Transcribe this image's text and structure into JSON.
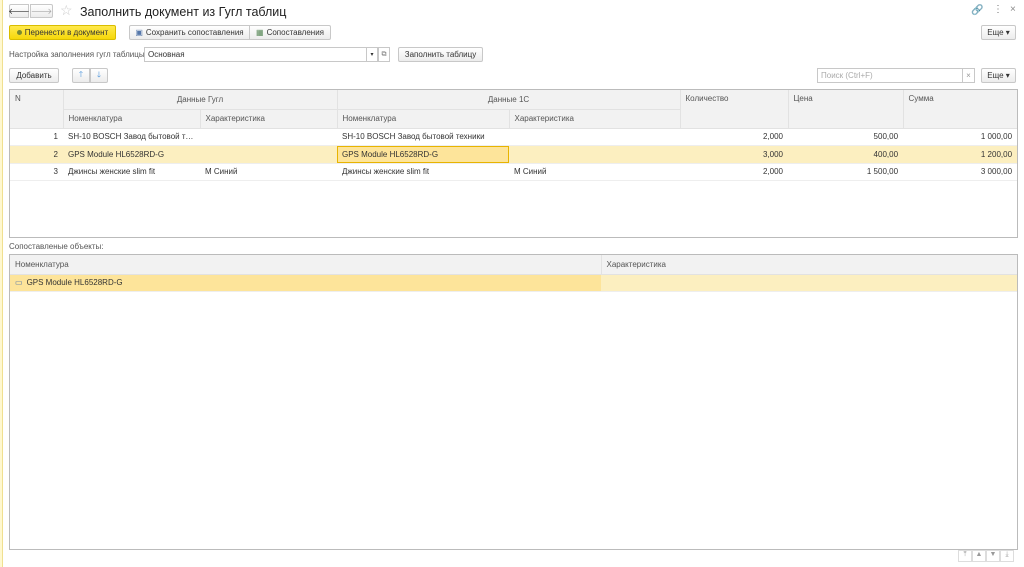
{
  "window": {
    "title": "Заполнить документ из Гугл таблиц"
  },
  "toolbar": {
    "transfer": "Перенести в документ",
    "save_mapping": "Сохранить сопоставления",
    "mappings": "Сопоставления",
    "more": "Еще ▾"
  },
  "settings": {
    "label": "Настройка заполнения гугл таблицы:",
    "value": "Основная",
    "fill_button": "Заполнить таблицу"
  },
  "table_toolbar": {
    "add": "Добавить",
    "search_placeholder": "Поиск (Ctrl+F)",
    "more": "Еще ▾"
  },
  "main_table": {
    "headers": {
      "n": "N",
      "google": "Данные Гугл",
      "c1": "Данные 1С",
      "nom": "Номенклатура",
      "char": "Характеристика",
      "qty": "Количество",
      "price": "Цена",
      "sum": "Сумма"
    },
    "rows": [
      {
        "n": "1",
        "g_nom": "SH-10 BOSCH Завод бытовой те...",
        "g_char": "",
        "c_nom": "SH-10 BOSCH Завод бытовой техники",
        "c_char": "",
        "qty": "2,000",
        "price": "500,00",
        "sum": "1 000,00"
      },
      {
        "n": "2",
        "g_nom": "GPS Module HL6528RD-G",
        "g_char": "",
        "c_nom": "GPS Module HL6528RD-G",
        "c_char": "",
        "qty": "3,000",
        "price": "400,00",
        "sum": "1 200,00"
      },
      {
        "n": "3",
        "g_nom": "Джинсы женские slim fit",
        "g_char": "М Синий",
        "c_nom": "Джинсы женские slim fit",
        "c_char": "М Синий",
        "qty": "2,000",
        "price": "1 500,00",
        "sum": "3 000,00"
      }
    ]
  },
  "matched": {
    "label": "Сопоставленые объекты:",
    "headers": {
      "nom": "Номенклатура",
      "char": "Характеристика"
    },
    "rows": [
      {
        "nom": "GPS Module HL6528RD-G",
        "char": ""
      }
    ]
  }
}
